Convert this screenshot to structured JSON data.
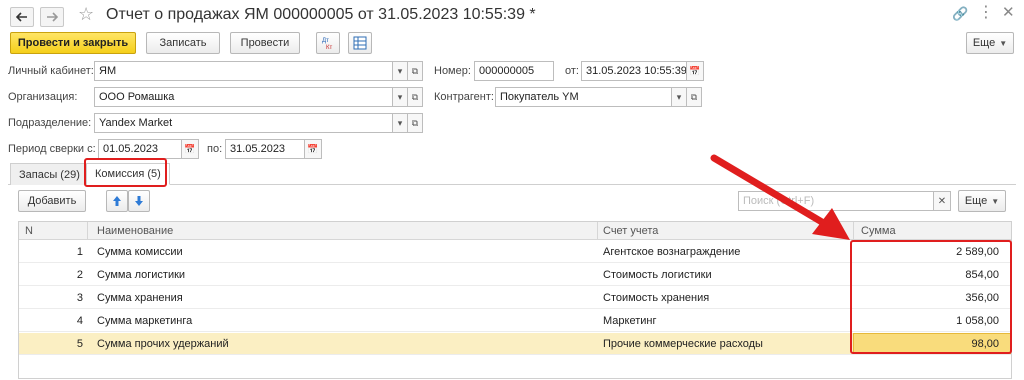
{
  "title": "Отчет о продажах ЯМ 000000005 от 31.05.2023 10:55:39 *",
  "toolbar": {
    "post_and_close": "Провести и закрыть",
    "save": "Записать",
    "post": "Провести",
    "more": "Еще"
  },
  "form": {
    "cabinet_label": "Личный кабинет:",
    "cabinet_value": "ЯМ",
    "number_label": "Номер:",
    "number_value": "000000005",
    "from_label": "от:",
    "date_value": "31.05.2023 10:55:39",
    "org_label": "Организация:",
    "org_value": "ООО Ромашка",
    "contractor_label": "Контрагент:",
    "contractor_value": "Покупатель YM",
    "division_label": "Подразделение:",
    "division_value": "Yandex Market",
    "period_label": "Период сверки с:",
    "period_from": "01.05.2023",
    "period_to_label": "по:",
    "period_to": "31.05.2023"
  },
  "tabs": [
    {
      "label": "Запасы (29)"
    },
    {
      "label": "Комиссия (5)"
    }
  ],
  "table_toolbar": {
    "add": "Добавить",
    "search_placeholder": "Поиск (Ctrl+F)",
    "more": "Еще"
  },
  "table": {
    "headers": [
      "N",
      "Наименование",
      "Счет учета",
      "Сумма"
    ],
    "rows": [
      {
        "n": "1",
        "name": "Сумма комиссии",
        "account": "Агентское вознаграждение",
        "sum": "2 589,00"
      },
      {
        "n": "2",
        "name": "Сумма логистики",
        "account": "Стоимость логистики",
        "sum": "854,00"
      },
      {
        "n": "3",
        "name": "Сумма хранения",
        "account": "Стоимость хранения",
        "sum": "356,00"
      },
      {
        "n": "4",
        "name": "Сумма маркетинга",
        "account": "Маркетинг",
        "sum": "1 058,00"
      },
      {
        "n": "5",
        "name": "Сумма прочих удержаний",
        "account": "Прочие коммерческие расходы",
        "sum": "98,00"
      }
    ]
  },
  "colors": {
    "accent_yellow": "#f5cf1a",
    "highlight": "#e01e1e",
    "selected_row": "#fbefc3"
  }
}
